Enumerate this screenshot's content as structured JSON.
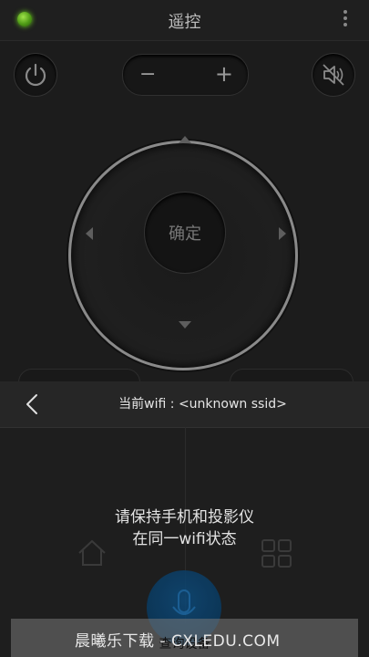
{
  "header": {
    "title": "遥控"
  },
  "volume": {
    "minus": "−",
    "plus": "+"
  },
  "dpad": {
    "ok_label": "确定"
  },
  "panel": {
    "wifi_prefix": "当前wifi : ",
    "wifi_ssid": "<unknown ssid>",
    "message_line1": "请保持手机和投影仪",
    "message_line2": "在同一wifi状态",
    "search_button": "查询设备"
  },
  "watermark": {
    "text": "晨曦乐下载 - CXLEDU.COM"
  },
  "colors": {
    "status_dot": "#6ccf1f",
    "mic_button": "#0a3a60"
  },
  "icons": [
    "status-dot-icon",
    "more-vert-icon",
    "power-icon",
    "mute-icon",
    "back-arrow-icon",
    "home-icon",
    "grid-icon",
    "mic-icon"
  ]
}
